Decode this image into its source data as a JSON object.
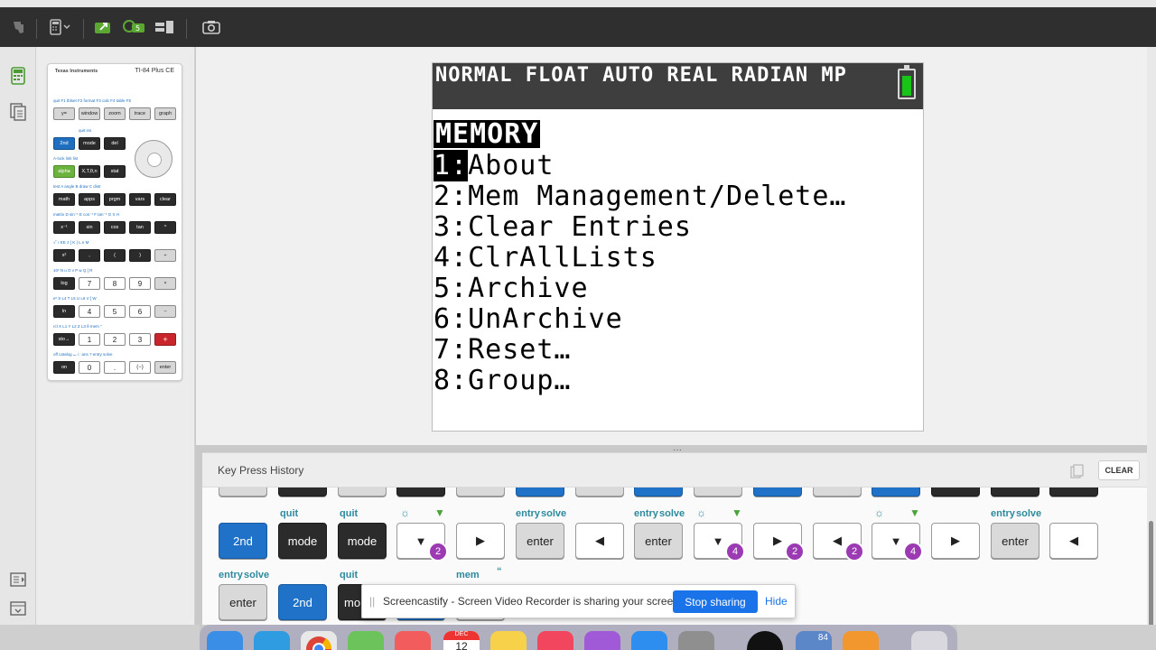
{
  "toolbar": {
    "icons": [
      "ti-logo-icon",
      "calculator-view-icon",
      "send-to-calculator-icon",
      "emulator-sync-icon",
      "layout-icon",
      "screenshot-icon"
    ]
  },
  "calculator": {
    "brand": "Texas Instruments",
    "model": "TI-84 Plus CE",
    "keys": {
      "y": "y=",
      "window": "window",
      "zoom": "zoom",
      "trace": "trace",
      "graph": "graph",
      "second": "2nd",
      "mode": "mode",
      "del": "del",
      "alpha": "alpha",
      "xt": "X,T,θ,n",
      "stat": "stat",
      "math": "math",
      "apps": "apps",
      "prgm": "prgm",
      "vars": "vars",
      "clear": "clear",
      "inv": "x⁻¹",
      "sin": "sin",
      "cos": "cos",
      "tan": "tan",
      "pow": "^",
      "sq": "x²",
      "comma": ",",
      "lparen": "(",
      "rparen": ")",
      "div": "÷",
      "log": "log",
      "k7": "7",
      "k8": "8",
      "k9": "9",
      "mul": "×",
      "ln": "ln",
      "k4": "4",
      "k5": "5",
      "k6": "6",
      "sub": "−",
      "sto": "sto→",
      "k1": "1",
      "k2": "2",
      "k3": "3",
      "add": "+",
      "on": "on",
      "k0": "0",
      "dot": ".",
      "neg": "(−)",
      "enter": "enter"
    },
    "labels": {
      "row1": "quit F1  tblset F2  format F3  calc F4  table F5",
      "row2": "quit   ins",
      "row3": "A-lock  link  list",
      "row4": "test A  angle B  draw C  distr",
      "row5": "matrix D  sin⁻¹ E  cos⁻¹ F  tan⁻¹ G  π H",
      "row6": "√‾ I  EE J  { K  } L  e M",
      "row7": "10ˣ N  u O  v P  w Q  [ R",
      "row8": "eˣ S  L4 T  L5 U  L6 V  ] W",
      "row9": "rcl X  L1 Y  L2 Z  L3 θ  mem \"",
      "row10": "off  catalog ⌴  i :  ans ?  entry solve"
    }
  },
  "screen": {
    "status": "NORMAL FLOAT AUTO REAL RADIAN MP",
    "battery_level": 1.0,
    "menu_title": "MEMORY",
    "items": [
      {
        "num": "1:",
        "label": "About"
      },
      {
        "num": "2:",
        "label": "Mem Management/Delete…"
      },
      {
        "num": "3:",
        "label": "Clear Entries"
      },
      {
        "num": "4:",
        "label": "ClrAllLists"
      },
      {
        "num": "5:",
        "label": "Archive"
      },
      {
        "num": "6:",
        "label": "UnArchive"
      },
      {
        "num": "7:",
        "label": "Reset…"
      },
      {
        "num": "8:",
        "label": "Group…"
      }
    ]
  },
  "history": {
    "title": "Key Press History",
    "clear_label": "CLEAR",
    "labels": {
      "quit": "quit",
      "entry": "entry",
      "solve": "solve",
      "mem": "mem",
      "quote": "“"
    },
    "row2": [
      {
        "label": "2nd",
        "style": "blue"
      },
      {
        "label": "mode",
        "style": "dark"
      },
      {
        "label": "mode",
        "style": "dark"
      },
      {
        "label": "▼",
        "style": "white",
        "badge": "2"
      },
      {
        "label": "▶",
        "style": "white"
      },
      {
        "label": "enter",
        "style": "grey"
      },
      {
        "label": "◀",
        "style": "white"
      },
      {
        "label": "enter",
        "style": "grey"
      },
      {
        "label": "▼",
        "style": "white",
        "badge": "4"
      },
      {
        "label": "▶",
        "style": "white",
        "badge": "2"
      },
      {
        "label": "◀",
        "style": "white",
        "badge": "2"
      },
      {
        "label": "▼",
        "style": "white",
        "badge": "4"
      },
      {
        "label": "▶",
        "style": "white"
      },
      {
        "label": "enter",
        "style": "grey"
      },
      {
        "label": "◀",
        "style": "white"
      }
    ],
    "row3": [
      {
        "label": "enter",
        "style": "grey"
      },
      {
        "label": "2nd",
        "style": "blue"
      },
      {
        "label": "mo",
        "style": "dark"
      }
    ]
  },
  "share_banner": {
    "text": "Screencastify - Screen Video Recorder is sharing your screen.",
    "stop_label": "Stop sharing",
    "hide_label": "Hide"
  },
  "dock": {
    "calendar_month": "DEC",
    "calendar_day": "12",
    "ti_badge": "84"
  }
}
